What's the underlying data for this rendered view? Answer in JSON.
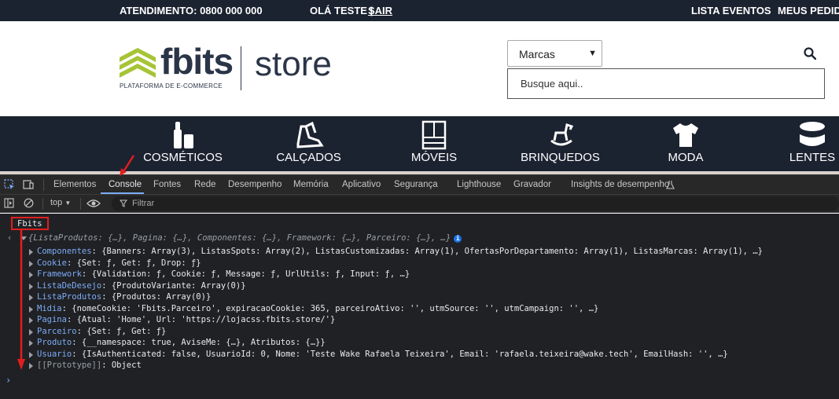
{
  "topbar": {
    "atendimento": "ATENDIMENTO: 0800 000 000",
    "greeting": "OLÁ TESTE |",
    "logout": "SAIR",
    "events": "LISTA EVENTOS",
    "orders": "MEUS PEDIDO"
  },
  "header": {
    "logo_name": "fbits",
    "logo_tagline": "PLATAFORMA DE E-COMMERCE",
    "logo_store": "store",
    "brand_select_value": "Marcas",
    "search_placeholder": "Busque aqui.."
  },
  "categories": [
    {
      "label": "COSMÉTICOS",
      "icon": "cosmetics-icon"
    },
    {
      "label": "CALÇADOS",
      "icon": "shoes-icon"
    },
    {
      "label": "MÓVEIS",
      "icon": "furniture-icon"
    },
    {
      "label": "BRINQUEDOS",
      "icon": "rocking-horse-icon"
    },
    {
      "label": "MODA",
      "icon": "tshirt-icon"
    },
    {
      "label": "LENTES",
      "icon": "lens-case-icon"
    }
  ],
  "devtools": {
    "tabs": [
      "Elementos",
      "Console",
      "Fontes",
      "Rede",
      "Desempenho",
      "Memória",
      "Aplicativo",
      "Segurança",
      "Lighthouse",
      "Gravador",
      "Insights de desempenho"
    ],
    "active_tab": "Console",
    "context": "top",
    "filter_placeholder": "Filtrar",
    "console_input": "Fbits",
    "summary": "{ListaProdutos: {…}, Pagina: {…}, Componentes: {…}, Framework: {…}, Parceiro: {…}, …}",
    "properties": [
      {
        "key": "Componentes",
        "value": "{Banners: Array(3), ListasSpots: Array(2), ListasCustomizadas: Array(1), OfertasPorDepartamento: Array(1), ListasMarcas: Array(1), …}"
      },
      {
        "key": "Cookie",
        "value": "{Set: ƒ, Get: ƒ, Drop: ƒ}"
      },
      {
        "key": "Framework",
        "value": "{Validation: ƒ, Cookie: ƒ, Message: ƒ, UrlUtils: ƒ, Input: ƒ, …}"
      },
      {
        "key": "ListaDeDesejo",
        "value": "{ProdutoVariante: Array(0)}"
      },
      {
        "key": "ListaProdutos",
        "value": "{Produtos: Array(0)}"
      },
      {
        "key": "Midia",
        "value": "{nomeCookie: 'Fbits.Parceiro', expiracaoCookie: 365, parceiroAtivo: '', utmSource: '', utmCampaign: '', …}"
      },
      {
        "key": "Pagina",
        "value": "{Atual: 'Home', Url: 'https://lojacss.fbits.store/'}"
      },
      {
        "key": "Parceiro",
        "value": "{Set: ƒ, Get: ƒ}"
      },
      {
        "key": "Produto",
        "value": "{__namespace: true, AviseMe: {…}, Atributos: {…}}"
      },
      {
        "key": "Usuario",
        "value": "{IsAuthenticated: false, UsuarioId: 0, Nome: 'Teste Wake Rafaela Teixeira', Email: 'rafaela.teixeira@wake.tech', EmailHash: '', …}"
      },
      {
        "key": "[[Prototype]]",
        "value": "Object"
      }
    ]
  }
}
